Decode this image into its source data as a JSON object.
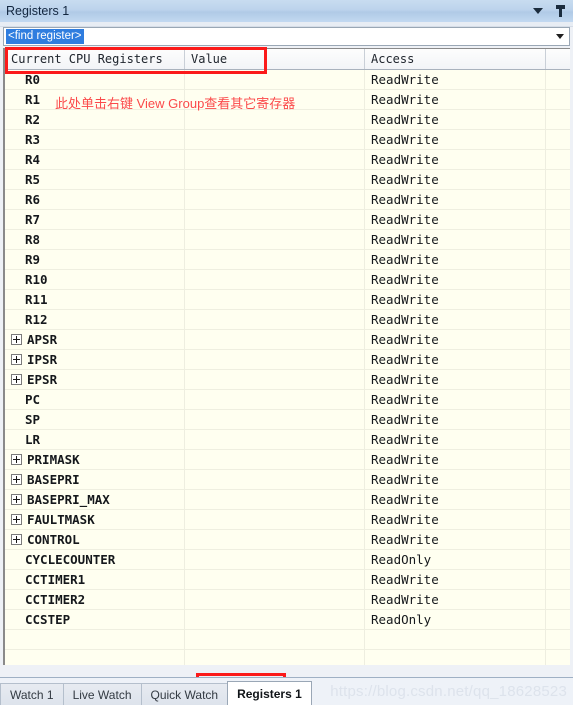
{
  "window": {
    "title": "Registers 1",
    "dropdown_icon": "chevron-down-icon",
    "pin_icon": "pin-icon"
  },
  "find": {
    "value": "<find register>",
    "dropdown_icon": "chevron-down-icon"
  },
  "grid": {
    "columns": [
      "Current CPU Registers",
      "Value",
      "Access",
      ""
    ],
    "rows": [
      {
        "name": "R0",
        "expandable": false,
        "value": "",
        "access": "ReadWrite"
      },
      {
        "name": "R1",
        "expandable": false,
        "value": "",
        "access": "ReadWrite"
      },
      {
        "name": "R2",
        "expandable": false,
        "value": "",
        "access": "ReadWrite"
      },
      {
        "name": "R3",
        "expandable": false,
        "value": "",
        "access": "ReadWrite"
      },
      {
        "name": "R4",
        "expandable": false,
        "value": "",
        "access": "ReadWrite"
      },
      {
        "name": "R5",
        "expandable": false,
        "value": "",
        "access": "ReadWrite"
      },
      {
        "name": "R6",
        "expandable": false,
        "value": "",
        "access": "ReadWrite"
      },
      {
        "name": "R7",
        "expandable": false,
        "value": "",
        "access": "ReadWrite"
      },
      {
        "name": "R8",
        "expandable": false,
        "value": "",
        "access": "ReadWrite"
      },
      {
        "name": "R9",
        "expandable": false,
        "value": "",
        "access": "ReadWrite"
      },
      {
        "name": "R10",
        "expandable": false,
        "value": "",
        "access": "ReadWrite"
      },
      {
        "name": "R11",
        "expandable": false,
        "value": "",
        "access": "ReadWrite"
      },
      {
        "name": "R12",
        "expandable": false,
        "value": "",
        "access": "ReadWrite"
      },
      {
        "name": "APSR",
        "expandable": true,
        "value": "",
        "access": "ReadWrite"
      },
      {
        "name": "IPSR",
        "expandable": true,
        "value": "",
        "access": "ReadWrite"
      },
      {
        "name": "EPSR",
        "expandable": true,
        "value": "",
        "access": "ReadWrite"
      },
      {
        "name": "PC",
        "expandable": false,
        "value": "",
        "access": "ReadWrite"
      },
      {
        "name": "SP",
        "expandable": false,
        "value": "",
        "access": "ReadWrite"
      },
      {
        "name": "LR",
        "expandable": false,
        "value": "",
        "access": "ReadWrite"
      },
      {
        "name": "PRIMASK",
        "expandable": true,
        "value": "",
        "access": "ReadWrite"
      },
      {
        "name": "BASEPRI",
        "expandable": true,
        "value": "",
        "access": "ReadWrite"
      },
      {
        "name": "BASEPRI_MAX",
        "expandable": true,
        "value": "",
        "access": "ReadWrite"
      },
      {
        "name": "FAULTMASK",
        "expandable": true,
        "value": "",
        "access": "ReadWrite"
      },
      {
        "name": "CONTROL",
        "expandable": true,
        "value": "",
        "access": "ReadWrite"
      },
      {
        "name": "CYCLECOUNTER",
        "expandable": false,
        "value": "",
        "access": "ReadOnly"
      },
      {
        "name": "CCTIMER1",
        "expandable": false,
        "value": "",
        "access": "ReadWrite"
      },
      {
        "name": "CCTIMER2",
        "expandable": false,
        "value": "",
        "access": "ReadWrite"
      },
      {
        "name": "CCSTEP",
        "expandable": false,
        "value": "",
        "access": "ReadOnly"
      },
      {
        "name": "",
        "expandable": false,
        "value": "",
        "access": ""
      },
      {
        "name": "",
        "expandable": false,
        "value": "",
        "access": ""
      }
    ]
  },
  "annotations": {
    "note": "此处单击右键 View Group查看其它寄存器",
    "color": "#fb4a4a",
    "box_color": "#fb1a1a"
  },
  "tabs": [
    {
      "label": "Watch 1",
      "active": false
    },
    {
      "label": "Live Watch",
      "active": false
    },
    {
      "label": "Quick Watch",
      "active": false
    },
    {
      "label": "Registers 1",
      "active": true
    }
  ],
  "watermark": "https://blog.csdn.net/qq_18628523"
}
